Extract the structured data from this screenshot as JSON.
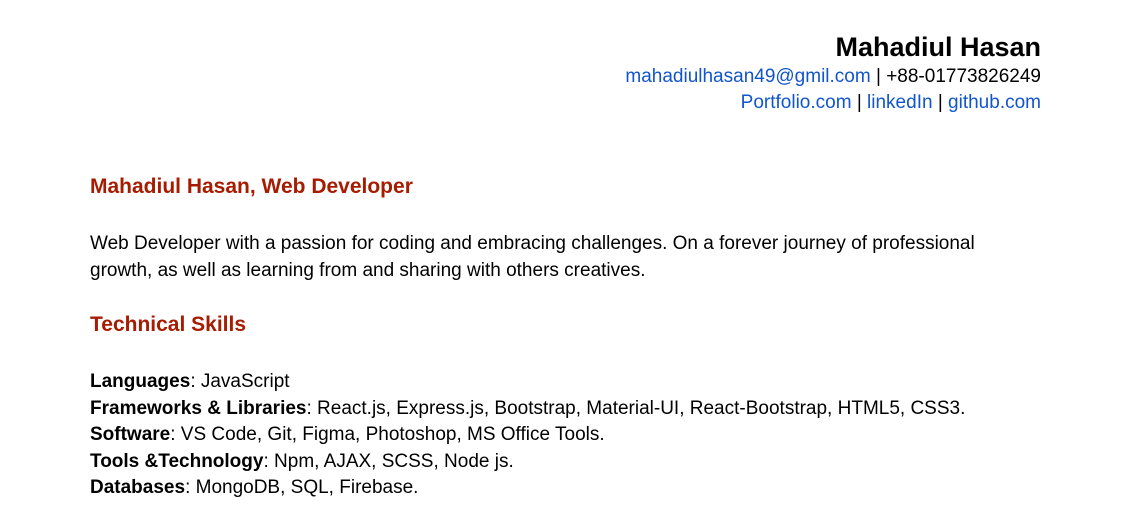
{
  "header": {
    "name": "Mahadiul Hasan",
    "email": "mahadiulhasan49@gmil.com",
    "phone": "+88-01773826249",
    "separator": " | ",
    "links": {
      "portfolio": "Portfolio.com",
      "linkedin": "linkedIn",
      "github": "github.com"
    }
  },
  "profile": {
    "title": "Mahadiul Hasan, Web Developer",
    "summary": "Web Developer with a passion for coding and embracing challenges. On a forever journey of professional growth, as well as learning from and sharing with others creatives."
  },
  "skills": {
    "title": "Technical Skills",
    "items": [
      {
        "label": "Languages",
        "value": ": JavaScript"
      },
      {
        "label": "Frameworks & Libraries",
        "value": ": React.js, Express.js, Bootstrap, Material-UI, React-Bootstrap, HTML5, CSS3."
      },
      {
        "label": "Software",
        "value": ": VS Code, Git, Figma, Photoshop, MS Office Tools."
      },
      {
        "label": "Tools &Technology",
        "value": ": Npm, AJAX, SCSS, Node js."
      },
      {
        "label": "Databases",
        "value": ": MongoDB, SQL, Firebase."
      }
    ]
  },
  "colors": {
    "heading": "#a61c00",
    "link": "#1155cc",
    "text": "#000000"
  }
}
